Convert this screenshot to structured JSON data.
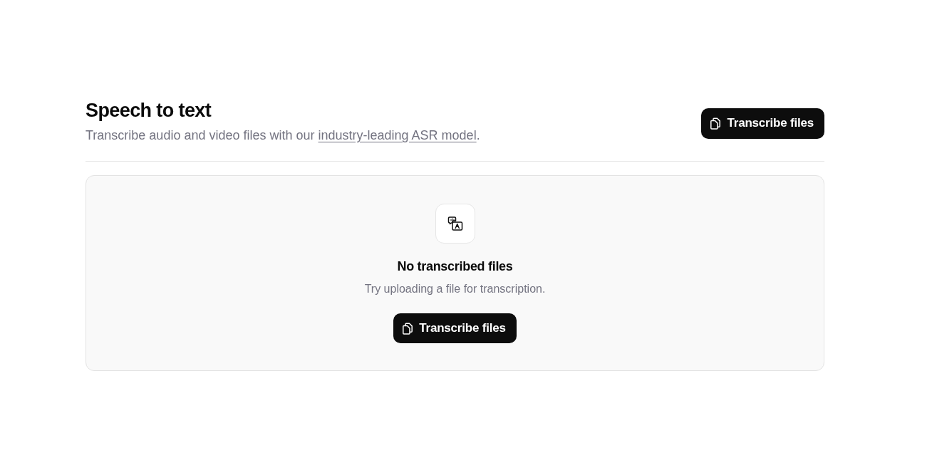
{
  "header": {
    "title": "Speech to text",
    "subtitle": {
      "before": "Transcribe audio and video files with our ",
      "link": "industry-leading ASR model",
      "after": "."
    },
    "button": "Transcribe files"
  },
  "empty_state": {
    "title": "No transcribed files",
    "description": "Try uploading a file for transcription.",
    "button": "Transcribe files"
  }
}
